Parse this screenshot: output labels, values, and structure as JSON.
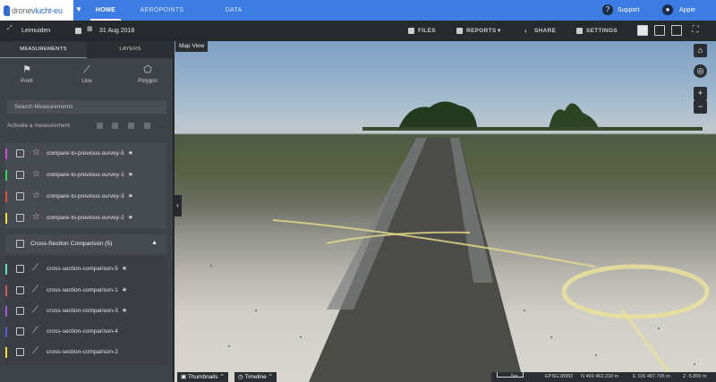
{
  "app": {
    "logo_prefix": "drone",
    "logo_suffix": "vlucht-eu",
    "nav": [
      "HOME",
      "AEROPOINTS",
      "DATA PROCESSING"
    ],
    "support": "Support",
    "user": "Appie"
  },
  "subbar": {
    "location": "Leimuiden",
    "date": "31 Aug 2018",
    "files": "FILES",
    "reports": "REPORTS",
    "share": "SHARE",
    "settings": "SETTINGS"
  },
  "sidebar": {
    "tabs": [
      "MEASUREMENTS",
      "LAYERS"
    ],
    "tools": [
      {
        "label": "Point",
        "icon": "flag-icon"
      },
      {
        "label": "Line",
        "icon": "line-icon"
      },
      {
        "label": "Polygon",
        "icon": "polygon-icon"
      }
    ],
    "search_placeholder": "Search Measurements",
    "activate_label": "Activate a measurement",
    "measurements": [
      {
        "label": "compare-to-previous-survey-5",
        "color": "#d648d6",
        "starred": true
      },
      {
        "label": "compare-to-previous-survey-1",
        "color": "#38d45a",
        "starred": true
      },
      {
        "label": "compare-to-previous-survey-3",
        "color": "#e0503a",
        "starred": true
      },
      {
        "label": "compare-to-previous-survey-2",
        "color": "#f0e23a",
        "starred": true
      }
    ],
    "group": {
      "label": "Cross-Section Comparison (5)",
      "items": [
        {
          "label": "cross-section-comparison-5",
          "color": "#5fe0b8",
          "starred": true
        },
        {
          "label": "cross-section-comparison-1",
          "color": "#e05a5a",
          "starred": true
        },
        {
          "label": "cross-section-comparison-3",
          "color": "#9a5ae0",
          "starred": true
        },
        {
          "label": "cross-section-comparison-4",
          "color": "#5a5ae0",
          "starred": false
        },
        {
          "label": "cross-section-comparison-2",
          "color": "#f0e23a",
          "starred": false
        }
      ]
    }
  },
  "viewport": {
    "label": "Map View",
    "thumbnails": "Thumbnails",
    "timeline": "Timeline",
    "scale": "5m",
    "epsg": "EPSG",
    "epsg_code": "28992",
    "north": "N  469 462.310 m",
    "east": "E  106 487.795 m",
    "z": "Z  -5.855 m"
  },
  "colors": {
    "accent": "#3c7be2",
    "panel": "#3e4249"
  }
}
